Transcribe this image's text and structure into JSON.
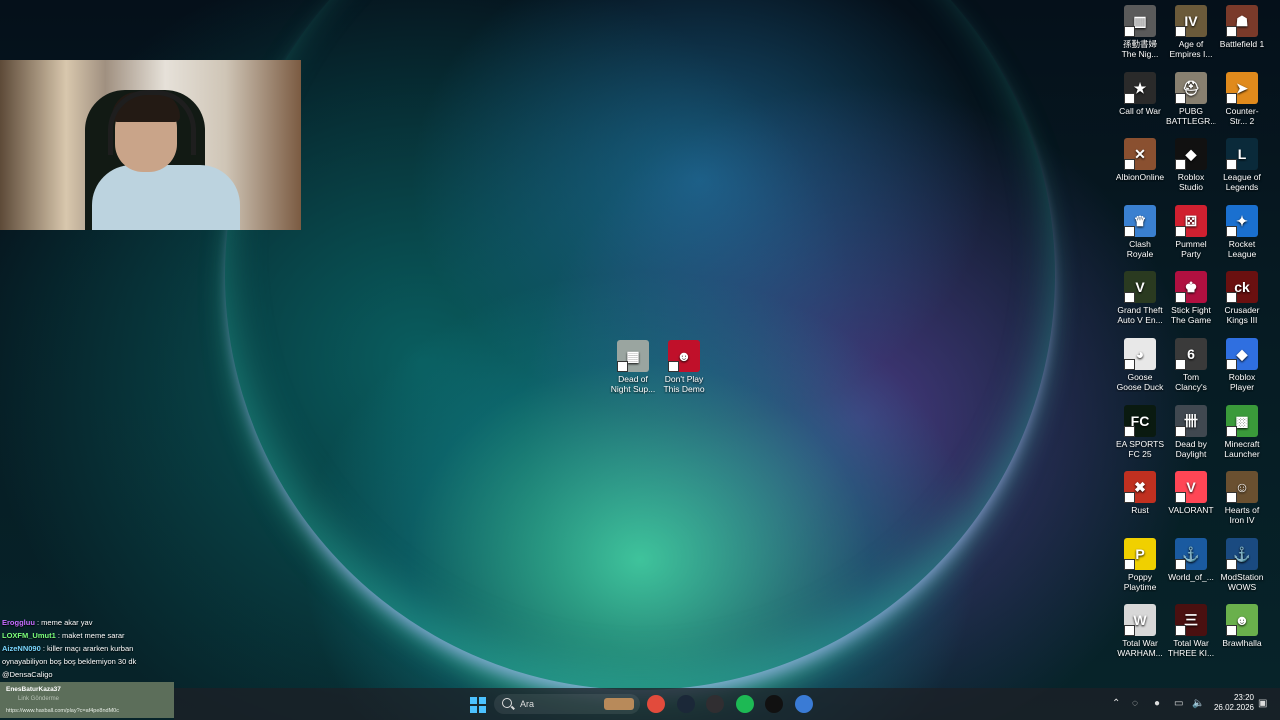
{
  "desktop": {
    "center_icons": [
      {
        "label": "Dead of Night Sup...",
        "color": "#9aa5a0",
        "glyph": "▦"
      },
      {
        "label": "Don't Play This Demo",
        "color": "#c0102a",
        "glyph": "☻"
      }
    ],
    "right_icons": [
      {
        "label": "孫勤書婦 The Nig...",
        "color": "#5a5a5a",
        "glyph": "▥"
      },
      {
        "label": "Age of Empires I...",
        "color": "#6b5a3a",
        "glyph": "IV"
      },
      {
        "label": "Battlefield 1",
        "color": "#7a3a2a",
        "glyph": "☗"
      },
      {
        "label": "Call of War",
        "color": "#2a2a2a",
        "glyph": "★"
      },
      {
        "label": "PUBG BATTLEGR...",
        "color": "#888070",
        "glyph": "⛑"
      },
      {
        "label": "Counter-Str... 2",
        "color": "#e08a1c",
        "glyph": "➤"
      },
      {
        "label": "AlbionOnline",
        "color": "#8a5030",
        "glyph": "✕"
      },
      {
        "label": "Roblox Studio",
        "color": "#111111",
        "glyph": "◆"
      },
      {
        "label": "League of Legends",
        "color": "#0a2a3a",
        "glyph": "L"
      },
      {
        "label": "Clash Royale",
        "color": "#3a80d0",
        "glyph": "♛"
      },
      {
        "label": "Pummel Party",
        "color": "#d02030",
        "glyph": "⚄"
      },
      {
        "label": "Rocket League",
        "color": "#1a70d0",
        "glyph": "✦"
      },
      {
        "label": "Grand Theft Auto V En...",
        "color": "#2a3a20",
        "glyph": "V"
      },
      {
        "label": "Stick Fight The Game",
        "color": "#b01040",
        "glyph": "♚"
      },
      {
        "label": "Crusader Kings III",
        "color": "#6a1010",
        "glyph": "ck"
      },
      {
        "label": "Goose Goose Duck",
        "color": "#e8e8e8",
        "glyph": "◕"
      },
      {
        "label": "Tom Clancy's Rainbow Si...",
        "color": "#3a3a3a",
        "glyph": "6"
      },
      {
        "label": "Roblox Player",
        "color": "#2f6fe0",
        "glyph": "◆"
      },
      {
        "label": "EA SPORTS FC 25",
        "color": "#0a1a10",
        "glyph": "FC"
      },
      {
        "label": "Dead by Daylight",
        "color": "#404850",
        "glyph": "卌"
      },
      {
        "label": "Minecraft Launcher",
        "color": "#3a9a3a",
        "glyph": "▩"
      },
      {
        "label": "Rust",
        "color": "#c03020",
        "glyph": "✖"
      },
      {
        "label": "VALORANT",
        "color": "#ff4655",
        "glyph": "V"
      },
      {
        "label": "Hearts of Iron IV",
        "color": "#6a5030",
        "glyph": "☺"
      },
      {
        "label": "Poppy Playtime",
        "color": "#f0d000",
        "glyph": "P"
      },
      {
        "label": "World_of_...",
        "color": "#1a5aa0",
        "glyph": "⚓"
      },
      {
        "label": "ModStation WOWS",
        "color": "#1a4a80",
        "glyph": "⚓"
      },
      {
        "label": "Total War WARHAM...",
        "color": "#d8d8d8",
        "glyph": "W"
      },
      {
        "label": "Total War THREE KI...",
        "color": "#4a1010",
        "glyph": "三"
      },
      {
        "label": "Brawlhalla",
        "color": "#6ab04c",
        "glyph": "☻"
      }
    ]
  },
  "chat": {
    "messages": [
      {
        "user": "Eroggluu",
        "text": " : meme akar yav",
        "color": "#c66cff"
      },
      {
        "user": "LOXFM_Umut1",
        "text": " : maket meme sarar",
        "color": "#7dff7a"
      },
      {
        "user": "AizeNN090",
        "text": " : killer maçı ararken kurban oynayabiliyon boş boş beklemiyon 30 dk",
        "color": "#7ad7ff"
      },
      {
        "user": "",
        "text": "@DensaCaligo",
        "color": "#ffffff"
      }
    ],
    "box": {
      "name": "EnesBaturKaza37",
      "hint": "Link Gönderme",
      "url": "https://www.haxball.com/play?c=af4pe8ndM0c"
    }
  },
  "taskbar": {
    "search_placeholder": "Ara",
    "apps": [
      {
        "name": "chrome-icon",
        "color": "#e24b3c"
      },
      {
        "name": "steam-icon",
        "color": "#1b2838"
      },
      {
        "name": "obs-icon",
        "color": "#302e31"
      },
      {
        "name": "spotify-icon",
        "color": "#1db954"
      },
      {
        "name": "capcut-icon",
        "color": "#111111"
      },
      {
        "name": "shield-app-icon",
        "color": "#3a7bd5"
      }
    ],
    "time": "23:20",
    "date": "26.02.2026"
  }
}
